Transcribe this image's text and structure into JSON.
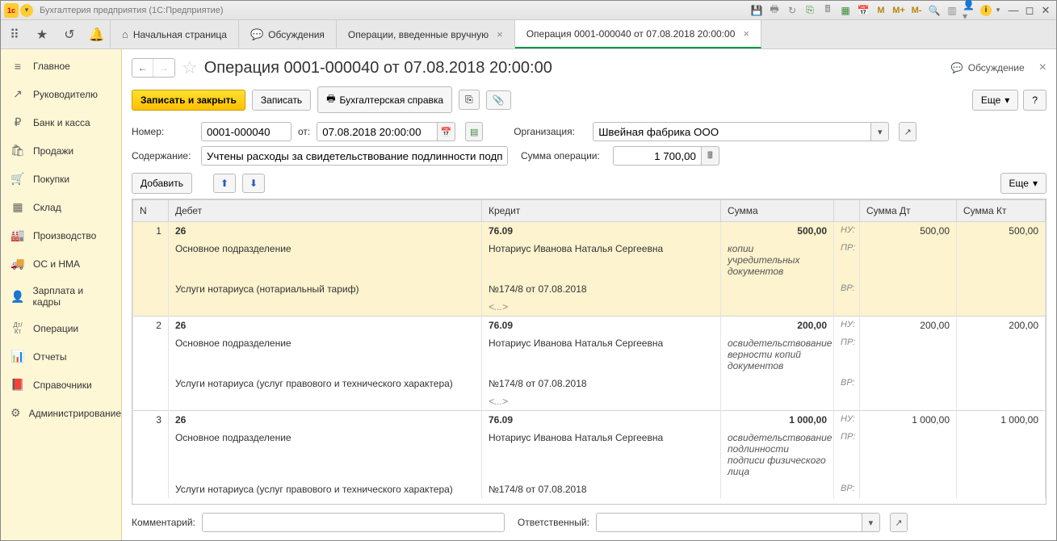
{
  "titlebar": {
    "title": "Бухгалтерия предприятия  (1С:Предприятие)"
  },
  "tabs": [
    {
      "label": "Начальная страница",
      "icon": "home",
      "closable": false
    },
    {
      "label": "Обсуждения",
      "icon": "chat",
      "closable": false
    },
    {
      "label": "Операции, введенные вручную",
      "icon": "",
      "closable": true
    },
    {
      "label": "Операция 0001-000040 от 07.08.2018 20:00:00",
      "icon": "",
      "closable": true,
      "active": true
    }
  ],
  "sidebar": {
    "items": [
      {
        "label": "Главное",
        "icon": "≡"
      },
      {
        "label": "Руководителю",
        "icon": "↗"
      },
      {
        "label": "Банк и касса",
        "icon": "₽"
      },
      {
        "label": "Продажи",
        "icon": "🛍"
      },
      {
        "label": "Покупки",
        "icon": "🛒"
      },
      {
        "label": "Склад",
        "icon": "▦"
      },
      {
        "label": "Производство",
        "icon": "🏭"
      },
      {
        "label": "ОС и НМА",
        "icon": "🚚"
      },
      {
        "label": "Зарплата и кадры",
        "icon": "👤"
      },
      {
        "label": "Операции",
        "icon": "Дт/Кт"
      },
      {
        "label": "Отчеты",
        "icon": "📊"
      },
      {
        "label": "Справочники",
        "icon": "📕"
      },
      {
        "label": "Администрирование",
        "icon": "⚙"
      }
    ]
  },
  "page": {
    "title": "Операция 0001-000040 от 07.08.2018 20:00:00",
    "discuss": "Обсуждение"
  },
  "toolbar": {
    "save_close": "Записать и закрыть",
    "save": "Записать",
    "print": "Бухгалтерская справка",
    "more": "Еще",
    "help": "?"
  },
  "form": {
    "num_lbl": "Номер:",
    "num_val": "0001-000040",
    "date_lbl": "от:",
    "date_val": "07.08.2018 20:00:00",
    "org_lbl": "Организация:",
    "org_val": "Швейная фабрика ООО",
    "desc_lbl": "Содержание:",
    "desc_val": "Учтены расходы за свидетельствование подлинности подписи на",
    "sum_lbl": "Сумма операции:",
    "sum_val": "1 700,00"
  },
  "tablebar": {
    "add": "Добавить",
    "more": "Еще"
  },
  "grid": {
    "headers": {
      "n": "N",
      "debit": "Дебет",
      "credit": "Кредит",
      "sum": "Сумма",
      "dt": "Сумма Дт",
      "kt": "Сумма Кт"
    },
    "tags": {
      "nu": "НУ:",
      "pr": "ПР:",
      "vr": "ВР:"
    },
    "rows": [
      {
        "n": "1",
        "deb_acc": "26",
        "kre_acc": "76.09",
        "sum": "500,00",
        "dt": "500,00",
        "kt": "500,00",
        "deb_sub1": "Основное подразделение",
        "kre_sub1": "Нотариус Иванова Наталья Сергеевна",
        "sum_note": "копии учредительных документов",
        "deb_sub2": "Услуги нотариуса (нотариальный тариф)",
        "kre_sub2": "№174/8 от 07.08.2018",
        "kre_sub3": "<...>",
        "sel": true
      },
      {
        "n": "2",
        "deb_acc": "26",
        "kre_acc": "76.09",
        "sum": "200,00",
        "dt": "200,00",
        "kt": "200,00",
        "deb_sub1": "Основное подразделение",
        "kre_sub1": "Нотариус Иванова Наталья Сергеевна",
        "sum_note": "освидетельствование верности копий документов",
        "deb_sub2": "Услуги нотариуса (услуг правового и технического характера)",
        "kre_sub2": "№174/8 от 07.08.2018",
        "kre_sub3": "<...>"
      },
      {
        "n": "3",
        "deb_acc": "26",
        "kre_acc": "76.09",
        "sum": "1 000,00",
        "dt": "1 000,00",
        "kt": "1 000,00",
        "deb_sub1": "Основное подразделение",
        "kre_sub1": "Нотариус Иванова Наталья Сергеевна",
        "sum_note": "освидетельствование подлинности подписи физического лица",
        "deb_sub2": "Услуги нотариуса (услуг правового и технического характера)",
        "kre_sub2": "№174/8 от 07.08.2018"
      }
    ]
  },
  "footer": {
    "comment_lbl": "Комментарий:",
    "comment_val": "",
    "resp_lbl": "Ответственный:",
    "resp_val": ""
  }
}
